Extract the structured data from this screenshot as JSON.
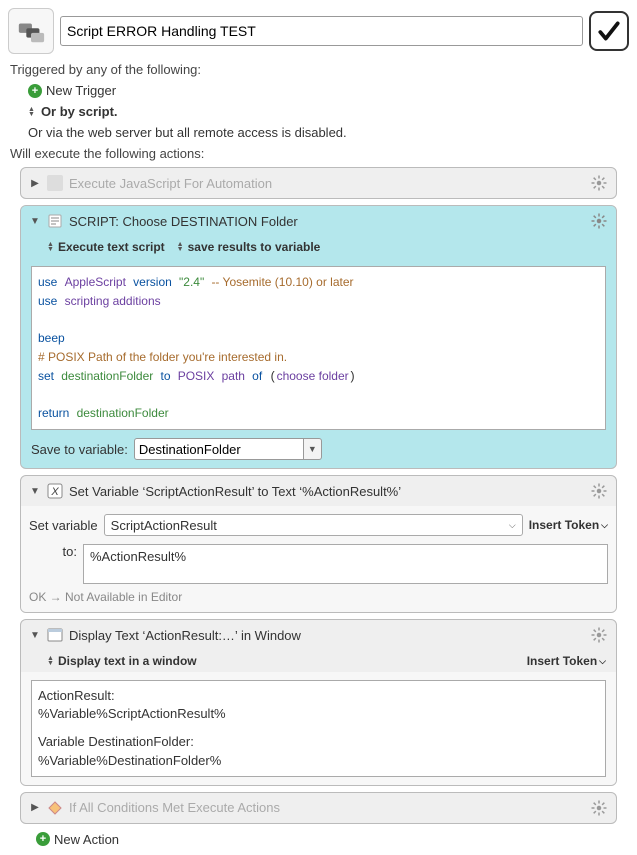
{
  "header": {
    "title": "Script ERROR Handling TEST"
  },
  "triggers": {
    "heading": "Triggered by any of the following:",
    "new_trigger": "New Trigger",
    "or_by_script": "Or by script.",
    "web_server": "Or via the web server but all remote access is disabled."
  },
  "actions_heading": "Will execute the following actions:",
  "actions": {
    "a0": {
      "title": "Execute JavaScript For Automation"
    },
    "a1": {
      "title": "SCRIPT:  Choose DESTINATION Folder",
      "sub_left": "Execute text script",
      "sub_right": "save results to variable",
      "save_label": "Save to variable:",
      "save_var": "DestinationFolder",
      "code": {
        "line1_use": "use",
        "line1_mod": "AppleScript",
        "line1_ver": "version",
        "line1_str": "\"2.4\"",
        "line1_cmt": "-- Yosemite (10.10) or later",
        "line2_use": "use",
        "line2_mod": "scripting additions",
        "line3": "beep",
        "line4": "# POSIX Path of the folder you're interested in.",
        "line5_set": "set",
        "line5_var": "destinationFolder",
        "line5_to": "to",
        "line5_posix": "POSIX",
        "line5_path": "path",
        "line5_of": "of",
        "line5_choose": "choose folder",
        "line6_ret": "return",
        "line6_var": "destinationFolder"
      }
    },
    "a2": {
      "title": "Set Variable ‘ScriptActionResult’ to Text ‘%ActionResult%’",
      "set_label": "Set variable",
      "var_name": "ScriptActionResult",
      "insert_token": "Insert Token",
      "to_label": "to:",
      "to_value": "%ActionResult%",
      "status": "OK → Not Available in Editor"
    },
    "a3": {
      "title": "Display Text ‘ActionResult:…’ in Window",
      "sub": "Display text in a window",
      "insert_token": "Insert Token",
      "body_l1": "ActionResult:",
      "body_l2": "%Variable%ScriptActionResult%",
      "body_l3": "Variable DestinationFolder:",
      "body_l4": "%Variable%DestinationFolder%"
    },
    "a4": {
      "title": "If All Conditions Met Execute Actions"
    }
  },
  "new_action": "New Action"
}
